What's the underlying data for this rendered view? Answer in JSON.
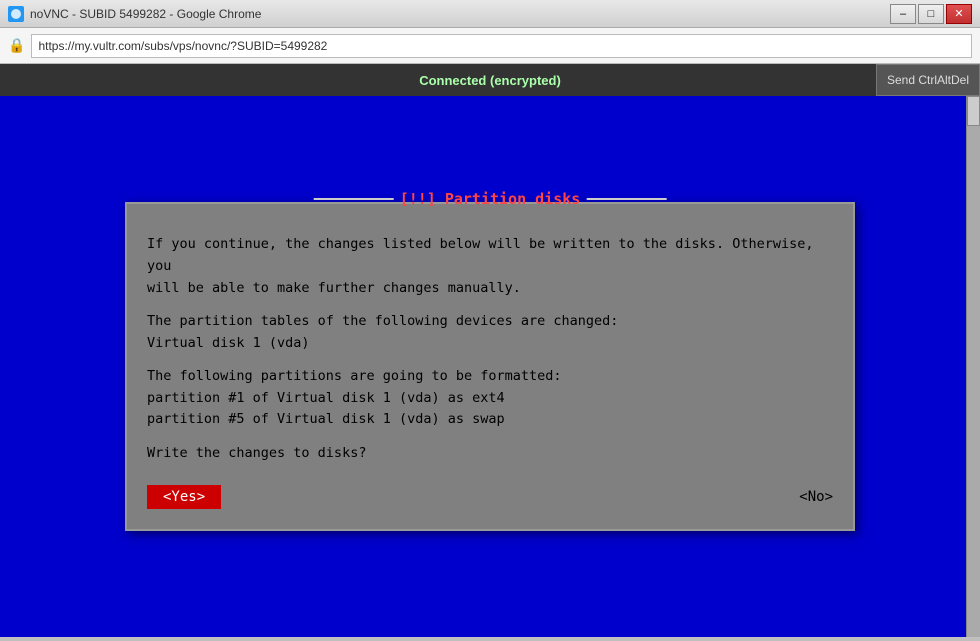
{
  "browser": {
    "title": "noVNC - SUBID 5499282 - Google Chrome",
    "url": "https://my.vultr.com/subs/vps/novnc/?SUBID=5499282",
    "min_btn": "–",
    "max_btn": "□",
    "close_btn": "✕"
  },
  "novnc": {
    "status": "Connected (encrypted)",
    "ctrl_btn": "Send CtrlAltDel"
  },
  "dialog": {
    "title": "[!!] Partition disks",
    "line1": "If you continue, the changes listed below will be written to the disks. Otherwise, you",
    "line2": "will be able to make further changes manually.",
    "line3": "The partition tables of the following devices are changed:",
    "line4": "    Virtual disk 1 (vda)",
    "line5": "The following partitions are going to be formatted:",
    "line6": "   partition #1 of Virtual disk 1 (vda) as ext4",
    "line7": "   partition #5 of Virtual disk 1 (vda) as swap",
    "line8": "Write the changes to disks?",
    "yes_btn": "<Yes>",
    "no_btn": "<No>"
  }
}
